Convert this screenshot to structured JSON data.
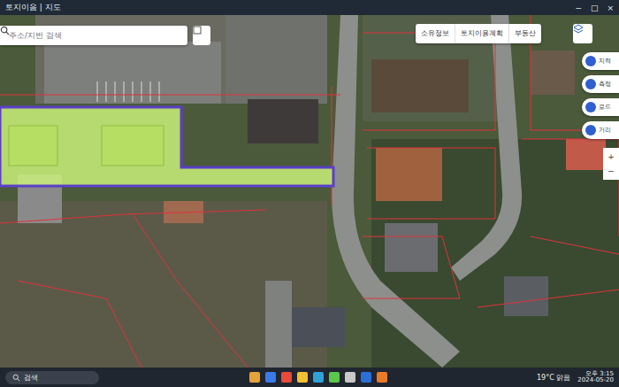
{
  "window": {
    "title": "토지이음 | 지도"
  },
  "window_controls": [
    "−",
    "□",
    "×"
  ],
  "search": {
    "placeholder": "주소/지번 검색"
  },
  "top_buttons": [
    {
      "label": "소유정보"
    },
    {
      "label": "토지이용계획"
    },
    {
      "label": "부동산"
    }
  ],
  "side_buttons": [
    {
      "label": "지적"
    },
    {
      "label": "측정"
    },
    {
      "label": "로드"
    },
    {
      "label": "거리"
    }
  ],
  "tools": [
    "+",
    "−"
  ],
  "map": {
    "parcel_selected": true
  },
  "taskbar": {
    "search": "검색",
    "weather": "19°C 맑음",
    "time": "오후 3:15",
    "date": "2024-05-20"
  }
}
